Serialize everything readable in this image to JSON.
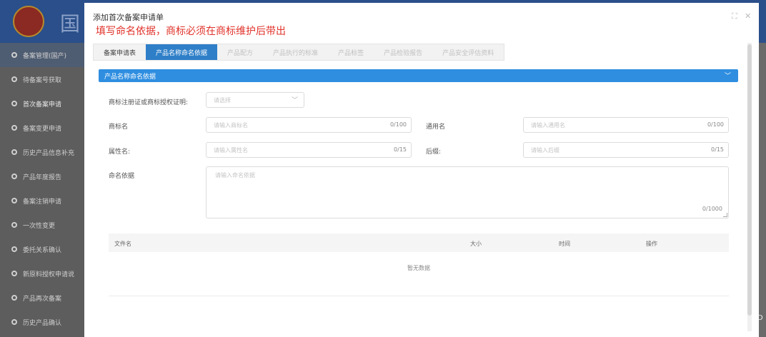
{
  "background": {
    "header_title": "国",
    "sidebar": {
      "group_label": "备案管理(国产)",
      "items": [
        {
          "label": "待备案号获取"
        },
        {
          "label": "首次备案申请"
        },
        {
          "label": "备案变更申请"
        },
        {
          "label": "历史产品信息补充"
        },
        {
          "label": "产品年度报告"
        },
        {
          "label": "备案注销申请"
        },
        {
          "label": "一次性变更"
        },
        {
          "label": "委托关系确认"
        },
        {
          "label": "新原料授权申请说"
        },
        {
          "label": "产品再次备案"
        },
        {
          "label": "历史产品确认"
        }
      ]
    },
    "right_edge_text": "D"
  },
  "modal": {
    "title": "添加首次备案申请单",
    "annotation": "填写命名依据，商标必须在商标维护后带出",
    "tabs": [
      {
        "label": "备案申请表"
      },
      {
        "label": "产品名称命名依据"
      },
      {
        "label": "产品配方"
      },
      {
        "label": "产品执行的标准"
      },
      {
        "label": "产品标签"
      },
      {
        "label": "产品检验报告"
      },
      {
        "label": "产品安全评估资料"
      }
    ],
    "section": {
      "title": "产品名称命名依据"
    },
    "form": {
      "trademark_cert": {
        "label": "商标注册证或商标授权证明:",
        "placeholder": "请选择"
      },
      "trademark_name": {
        "label": "商标名",
        "placeholder": "请输入商标名",
        "count": "0/100"
      },
      "common_name": {
        "label": "通用名",
        "placeholder": "请输入通用名",
        "count": "0/100"
      },
      "attribute_name": {
        "label": "属性名:",
        "placeholder": "请输入属性名",
        "count": "0/15"
      },
      "suffix": {
        "label": "后缀:",
        "placeholder": "请输入后缀",
        "count": "0/15"
      },
      "naming_basis": {
        "label": "命名依据",
        "placeholder": "请输入命名依据",
        "count": "0/1000"
      }
    },
    "table": {
      "columns": [
        "文件名",
        "大小",
        "时间",
        "操作"
      ],
      "empty_text": "暂无数据"
    }
  },
  "icons": [
    "maximize-icon",
    "close-icon",
    "chevron-down-icon",
    "resize-grip-icon"
  ]
}
